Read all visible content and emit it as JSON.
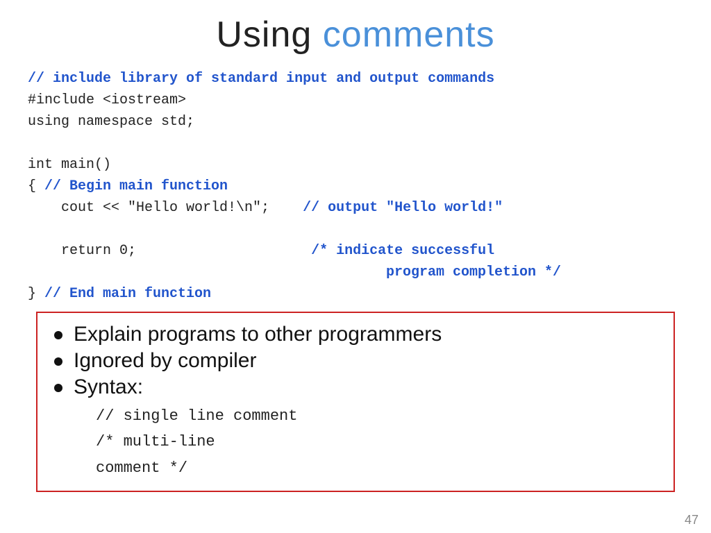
{
  "title": {
    "prefix": "Using ",
    "accent": "comments"
  },
  "code": {
    "comment_line": "// include library of standard input and output commands",
    "include": "#include <iostream>",
    "namespace": "using namespace std;",
    "blank1": "",
    "main_decl": "int main()",
    "brace_open": "{ ",
    "begin_comment": "// Begin main function",
    "cout_line": "    cout << \"Hello world!\\n\";",
    "cout_comment": "// output \"Hello world!\"",
    "blank2": "",
    "return_line": "    return 0;",
    "return_comment_1": "/* indicate successful",
    "return_comment_2": "   program completion */",
    "brace_close": "} ",
    "end_comment": "// End main function"
  },
  "bullets": {
    "item1": "Explain programs to other programmers",
    "item2": "Ignored by compiler",
    "item3": "Syntax:",
    "syntax1": "// single line comment",
    "syntax2": "/* multi-line",
    "syntax3": "   comment */"
  },
  "page_number": "47"
}
